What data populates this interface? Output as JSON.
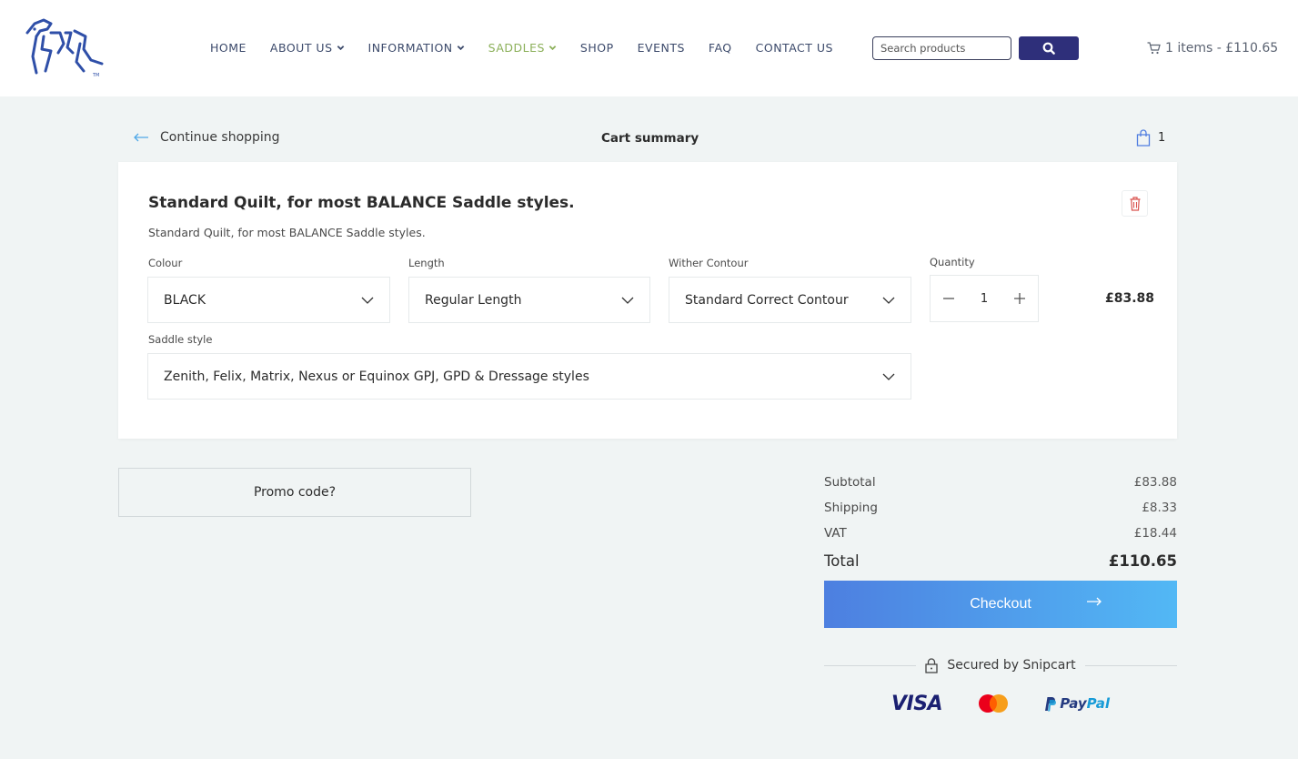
{
  "header": {
    "nav": [
      {
        "label": "HOME",
        "dropdown": false,
        "active": false
      },
      {
        "label": "ABOUT US",
        "dropdown": true,
        "active": false
      },
      {
        "label": "INFORMATION",
        "dropdown": true,
        "active": false
      },
      {
        "label": "SADDLES",
        "dropdown": true,
        "active": true
      },
      {
        "label": "SHOP",
        "dropdown": false,
        "active": false
      },
      {
        "label": "EVENTS",
        "dropdown": false,
        "active": false
      },
      {
        "label": "FAQ",
        "dropdown": false,
        "active": false
      },
      {
        "label": "CONTACT US",
        "dropdown": false,
        "active": false
      }
    ],
    "search_placeholder": "Search products",
    "search_icon": "magnifier-icon",
    "cart_label": "1 items - £110.65",
    "colors": {
      "nav": "#3c4a6b",
      "active": "#8cb05a",
      "search_button": "#2e2f7a",
      "logo": "#2f4fa8"
    }
  },
  "cart": {
    "continue_label": "Continue shopping",
    "summary_title": "Cart summary",
    "bag_count": "1"
  },
  "item": {
    "title": "Standard Quilt, for most BALANCE Saddle styles.",
    "description": "Standard Quilt, for most BALANCE Saddle styles.",
    "fields": {
      "colour": {
        "label": "Colour",
        "value": "BLACK"
      },
      "length": {
        "label": "Length",
        "value": "Regular Length"
      },
      "wither": {
        "label": "Wither Contour",
        "value": "Standard Correct Contour"
      },
      "saddle_style": {
        "label": "Saddle style",
        "value": "Zenith, Felix, Matrix, Nexus or Equinox GPJ, GPD & Dressage styles"
      }
    },
    "quantity_label": "Quantity",
    "quantity": "1",
    "price": "£83.88"
  },
  "promo": {
    "label": "Promo code?"
  },
  "summary": {
    "subtotal": {
      "label": "Subtotal",
      "value": "£83.88"
    },
    "shipping": {
      "label": "Shipping",
      "value": "£8.33"
    },
    "vat": {
      "label": "VAT",
      "value": "£18.44"
    },
    "total": {
      "label": "Total",
      "value": "£110.65"
    }
  },
  "checkout": {
    "label": "Checkout",
    "colors": {
      "from": "#4d7fe0",
      "to": "#52b8f5"
    }
  },
  "secured": {
    "label": "Secured by Snipcart"
  },
  "payments": {
    "visa": "VISA",
    "paypal_pay": "Pay",
    "paypal_pal": "Pal"
  }
}
